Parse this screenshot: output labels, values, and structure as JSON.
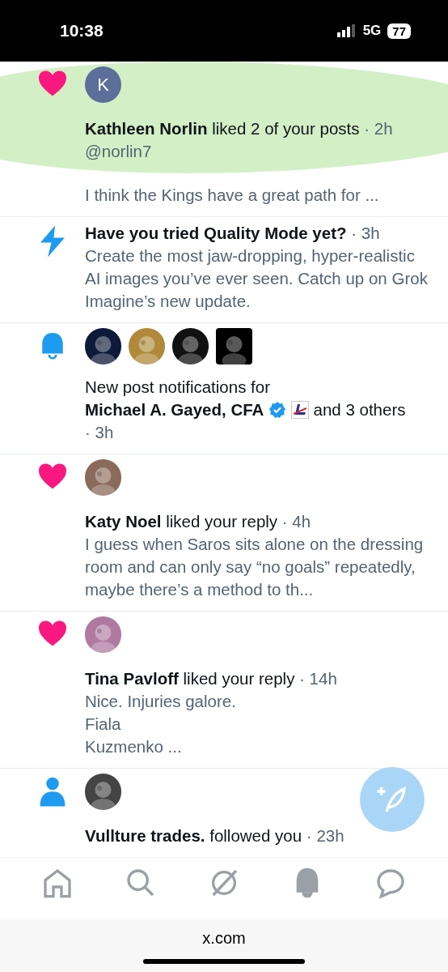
{
  "status_bar": {
    "time": "10:38",
    "network": "5G",
    "battery": "77"
  },
  "notifications": [
    {
      "kind": "like",
      "avatars": [
        {
          "kind": "letter",
          "letter": "K",
          "color": "#5b6f9a"
        }
      ],
      "headline": "**Kathleen Norlin** liked 2 of your posts",
      "time": "· 2h",
      "handle": "@norlin7",
      "body": [
        "I think the Kings have a great path for ..."
      ],
      "redacted": true
    },
    {
      "kind": "promo",
      "title": "Have you tried Quality Mode yet?",
      "time": "· 3h",
      "body": [
        "Create the most jaw-dropping, hyper-realistic AI images you’ve ever seen. Catch up on Grok Imagine’s new update."
      ]
    },
    {
      "kind": "alerts",
      "avatars": [
        {
          "kind": "picture",
          "color": "#0e1a3a"
        },
        {
          "kind": "picture",
          "color": "#b08a3a"
        },
        {
          "kind": "picture",
          "color": "#111111"
        },
        {
          "kind": "picture",
          "color": "#000000",
          "square": true
        }
      ],
      "intro": "New post notifications for",
      "name": "Michael A. Gayed, CFA",
      "verified": true,
      "others": "and 3 others",
      "time": "· 3h"
    },
    {
      "kind": "like",
      "avatars": [
        {
          "kind": "picture",
          "color": "#8a6a58"
        }
      ],
      "headline": "**Katy Noel** liked your reply",
      "time": "· 4h",
      "body": [
        "I guess when Saros sits alone on the dressing room and can only say “no goals” repeatedly,  maybe there’s a method to th..."
      ]
    },
    {
      "kind": "like",
      "avatars": [
        {
          "kind": "picture",
          "color": "#b07aa0"
        }
      ],
      "headline": "**Tina Pavloff** liked your reply",
      "time": "· 14h",
      "body": [
        "Nice. Injuries galore.",
        "Fiala",
        "Kuzmenko ..."
      ]
    },
    {
      "kind": "follow",
      "avatars": [
        {
          "kind": "picture",
          "color": "#444444"
        }
      ],
      "headline": "**Vullture trades.** followed you",
      "time": "· 23h"
    }
  ],
  "nav": [
    {
      "kind": "home",
      "selected": false
    },
    {
      "kind": "search",
      "selected": false
    },
    {
      "kind": "grok",
      "selected": false
    },
    {
      "kind": "bell",
      "selected": true
    },
    {
      "kind": "chat",
      "selected": false
    }
  ],
  "browser": {
    "url": "x.com"
  }
}
